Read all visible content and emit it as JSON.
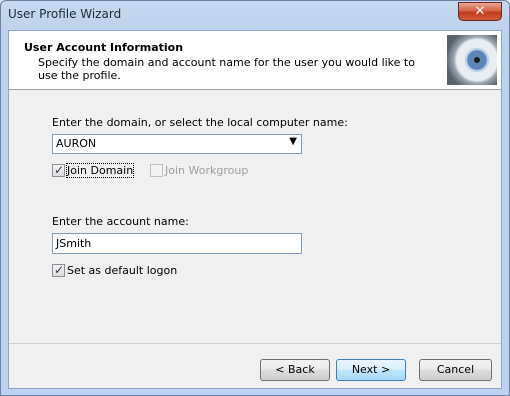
{
  "window": {
    "title": "User Profile Wizard",
    "close_label": "✕"
  },
  "header": {
    "title": "User Account  Information",
    "subtitle": "Specify the domain and account name for the user you would like to use the profile."
  },
  "domain": {
    "label": "Enter the domain, or select the local computer name:",
    "value": "AURON"
  },
  "join_domain": {
    "label": "Join Domain",
    "checked": true
  },
  "join_workgroup": {
    "label": "Join Workgroup",
    "checked": false
  },
  "account": {
    "label": "Enter the account name:",
    "value": "JSmith"
  },
  "default_logon": {
    "label": "Set as default logon",
    "checked": true
  },
  "buttons": {
    "back": "< Back",
    "next": "Next >",
    "cancel": "Cancel"
  }
}
